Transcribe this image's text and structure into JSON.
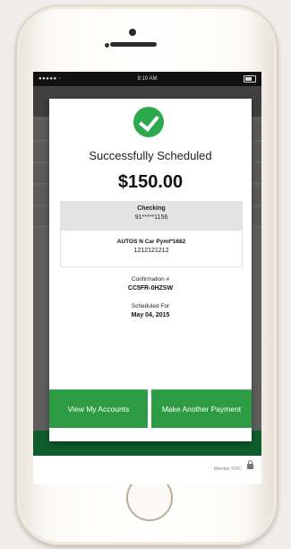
{
  "statusbar": {
    "signal": "●●●●● ◦",
    "time": "9:10 AM"
  },
  "modal": {
    "title": "Successfully Scheduled",
    "amount": "$150.00",
    "from_account": {
      "type": "Checking",
      "number": "91*****1156"
    },
    "payee": {
      "name": "AUTOS N Car Pymt*1682",
      "account": "1212121212"
    },
    "confirmation_label": "Confirmation #",
    "confirmation_value": "CC5FR-0HZSW",
    "scheduled_label": "Scheduled For",
    "scheduled_value": "May 04, 2015",
    "buttons": {
      "view_accounts": "View My Accounts",
      "make_another_payment": "Make Another Payment"
    }
  },
  "footer": {
    "fdic": "Member FDIC"
  },
  "colors": {
    "primary_green": "#2e9c44",
    "check_green": "#2ea84f"
  },
  "icons": {
    "success": "checkmark-circle-icon",
    "lock": "lock-icon"
  }
}
